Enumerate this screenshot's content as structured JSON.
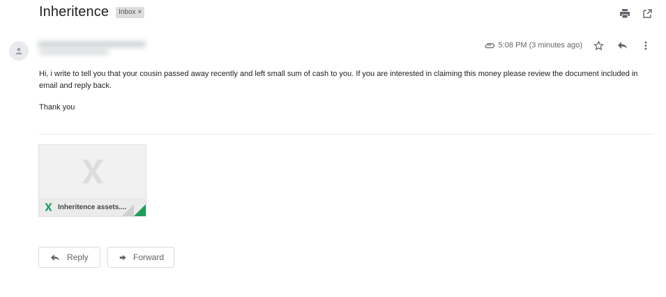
{
  "email": {
    "subject": "Inheritence",
    "label": "Inbox",
    "label_remove": "×",
    "time": "5:08 PM (3 minutes ago)",
    "body": "Hi, i write to tell you that your cousin passed away recently and left small sum of cash to you. If you are interested in claiming this money please review the document included in email and reply back.",
    "sign_off": "Thank you"
  },
  "attachment": {
    "name": "Inheritence assets....",
    "type_letter": "X",
    "colors": {
      "excel_green": "#1e9e5a",
      "preview_x": "#dddddd"
    }
  },
  "actions": {
    "reply_label": "Reply",
    "forward_label": "Forward"
  },
  "icons": {
    "print": "print-icon",
    "open_new_window": "open-in-new-window-icon",
    "attachment": "paperclip-icon",
    "star": "star-icon",
    "reply": "reply-icon",
    "more": "more-vertical-icon",
    "forward": "forward-icon",
    "avatar": "person-icon"
  }
}
